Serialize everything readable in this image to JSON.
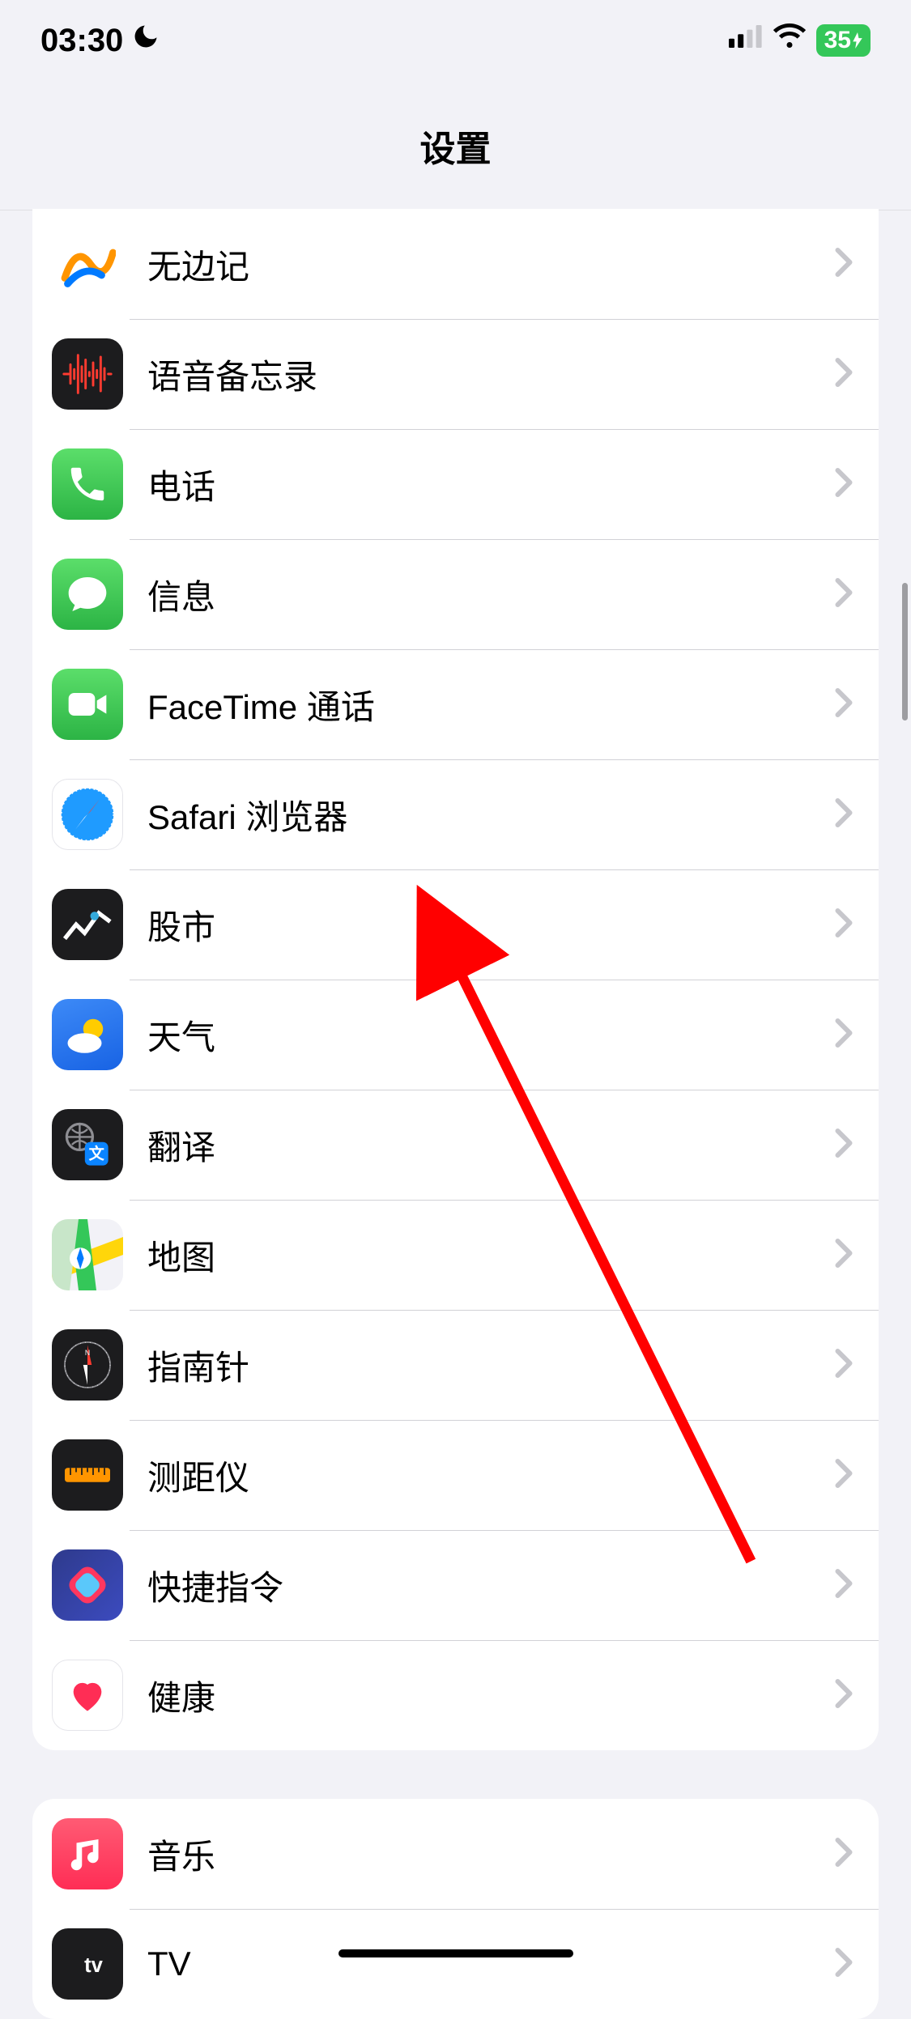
{
  "statusBar": {
    "time": "03:30",
    "battery": "35"
  },
  "nav": {
    "title": "设置"
  },
  "section1": {
    "items": [
      {
        "id": "freeform",
        "label": "无边记"
      },
      {
        "id": "voicememos",
        "label": "语音备忘录"
      },
      {
        "id": "phone",
        "label": "电话"
      },
      {
        "id": "messages",
        "label": "信息"
      },
      {
        "id": "facetime",
        "label": "FaceTime 通话"
      },
      {
        "id": "safari",
        "label": "Safari 浏览器"
      },
      {
        "id": "stocks",
        "label": "股市"
      },
      {
        "id": "weather",
        "label": "天气"
      },
      {
        "id": "translate",
        "label": "翻译"
      },
      {
        "id": "maps",
        "label": "地图"
      },
      {
        "id": "compass",
        "label": "指南针"
      },
      {
        "id": "measure",
        "label": "测距仪"
      },
      {
        "id": "shortcuts",
        "label": "快捷指令"
      },
      {
        "id": "health",
        "label": "健康"
      }
    ]
  },
  "section2": {
    "items": [
      {
        "id": "music",
        "label": "音乐"
      },
      {
        "id": "tv",
        "label": "TV"
      }
    ]
  }
}
